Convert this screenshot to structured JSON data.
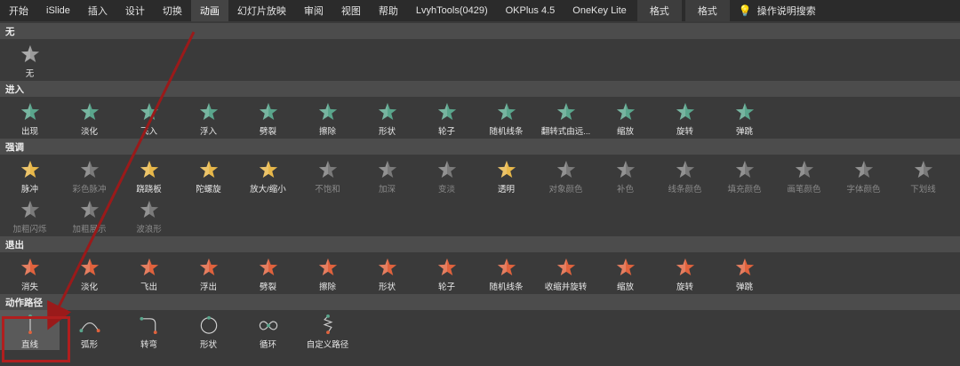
{
  "tabs": [
    {
      "label": "开始",
      "active": false
    },
    {
      "label": "iSlide",
      "active": false
    },
    {
      "label": "插入",
      "active": false
    },
    {
      "label": "设计",
      "active": false
    },
    {
      "label": "切换",
      "active": false
    },
    {
      "label": "动画",
      "active": true
    },
    {
      "label": "幻灯片放映",
      "active": false
    },
    {
      "label": "审阅",
      "active": false
    },
    {
      "label": "视图",
      "active": false
    },
    {
      "label": "帮助",
      "active": false
    },
    {
      "label": "LvyhTools(0429)",
      "active": false
    },
    {
      "label": "OKPlus 4.5",
      "active": false
    },
    {
      "label": "OneKey Lite",
      "active": false
    },
    {
      "label": "格式",
      "active": false
    },
    {
      "label": "格式",
      "active": false
    }
  ],
  "search": {
    "label": "操作说明搜索",
    "icon": "lightbulb-icon"
  },
  "colors": {
    "entrance": "#5aa58c",
    "emphasis": "#e8b84a",
    "emphasis_dim": "#7a7a7a",
    "exit": "#e0623d",
    "none": "#9a9a9a",
    "highlight_box": "#b01e1e"
  },
  "sections": {
    "none": {
      "title": "无",
      "items": [
        {
          "label": "无",
          "icon": "star-none-icon"
        }
      ]
    },
    "entrance": {
      "title": "进入",
      "items": [
        {
          "label": "出现"
        },
        {
          "label": "淡化"
        },
        {
          "label": "飞入"
        },
        {
          "label": "浮入"
        },
        {
          "label": "劈裂"
        },
        {
          "label": "擦除"
        },
        {
          "label": "形状"
        },
        {
          "label": "轮子"
        },
        {
          "label": "随机线条"
        },
        {
          "label": "翻转式由远..."
        },
        {
          "label": "缩放"
        },
        {
          "label": "旋转"
        },
        {
          "label": "弹跳"
        }
      ]
    },
    "emphasis": {
      "title": "强调",
      "items": [
        {
          "label": "脉冲",
          "dim": false
        },
        {
          "label": "彩色脉冲",
          "dim": true
        },
        {
          "label": "跷跷板",
          "dim": false
        },
        {
          "label": "陀螺旋",
          "dim": false
        },
        {
          "label": "放大/缩小",
          "dim": false
        },
        {
          "label": "不饱和",
          "dim": true
        },
        {
          "label": "加深",
          "dim": true
        },
        {
          "label": "变淡",
          "dim": true
        },
        {
          "label": "透明",
          "dim": false
        },
        {
          "label": "对象颜色",
          "dim": true
        },
        {
          "label": "补色",
          "dim": true
        },
        {
          "label": "线条颜色",
          "dim": true
        },
        {
          "label": "填充颜色",
          "dim": true
        },
        {
          "label": "画笔颜色",
          "dim": true
        },
        {
          "label": "字体颜色",
          "dim": true
        },
        {
          "label": "下划线",
          "dim": true
        },
        {
          "label": "加粗闪烁",
          "dim": true
        },
        {
          "label": "加粗展示",
          "dim": true
        },
        {
          "label": "波浪形",
          "dim": true
        }
      ]
    },
    "exit": {
      "title": "退出",
      "items": [
        {
          "label": "消失"
        },
        {
          "label": "淡化"
        },
        {
          "label": "飞出"
        },
        {
          "label": "浮出"
        },
        {
          "label": "劈裂"
        },
        {
          "label": "擦除"
        },
        {
          "label": "形状"
        },
        {
          "label": "轮子"
        },
        {
          "label": "随机线条"
        },
        {
          "label": "收缩并旋转"
        },
        {
          "label": "缩放"
        },
        {
          "label": "旋转"
        },
        {
          "label": "弹跳"
        }
      ]
    },
    "motion": {
      "title": "动作路径",
      "items": [
        {
          "label": "直线",
          "icon": "path-line-icon",
          "selected": true
        },
        {
          "label": "弧形",
          "icon": "path-arc-icon"
        },
        {
          "label": "转弯",
          "icon": "path-turn-icon"
        },
        {
          "label": "形状",
          "icon": "path-circle-icon"
        },
        {
          "label": "循环",
          "icon": "path-loop-icon"
        },
        {
          "label": "自定义路径",
          "icon": "path-custom-icon"
        }
      ]
    }
  }
}
